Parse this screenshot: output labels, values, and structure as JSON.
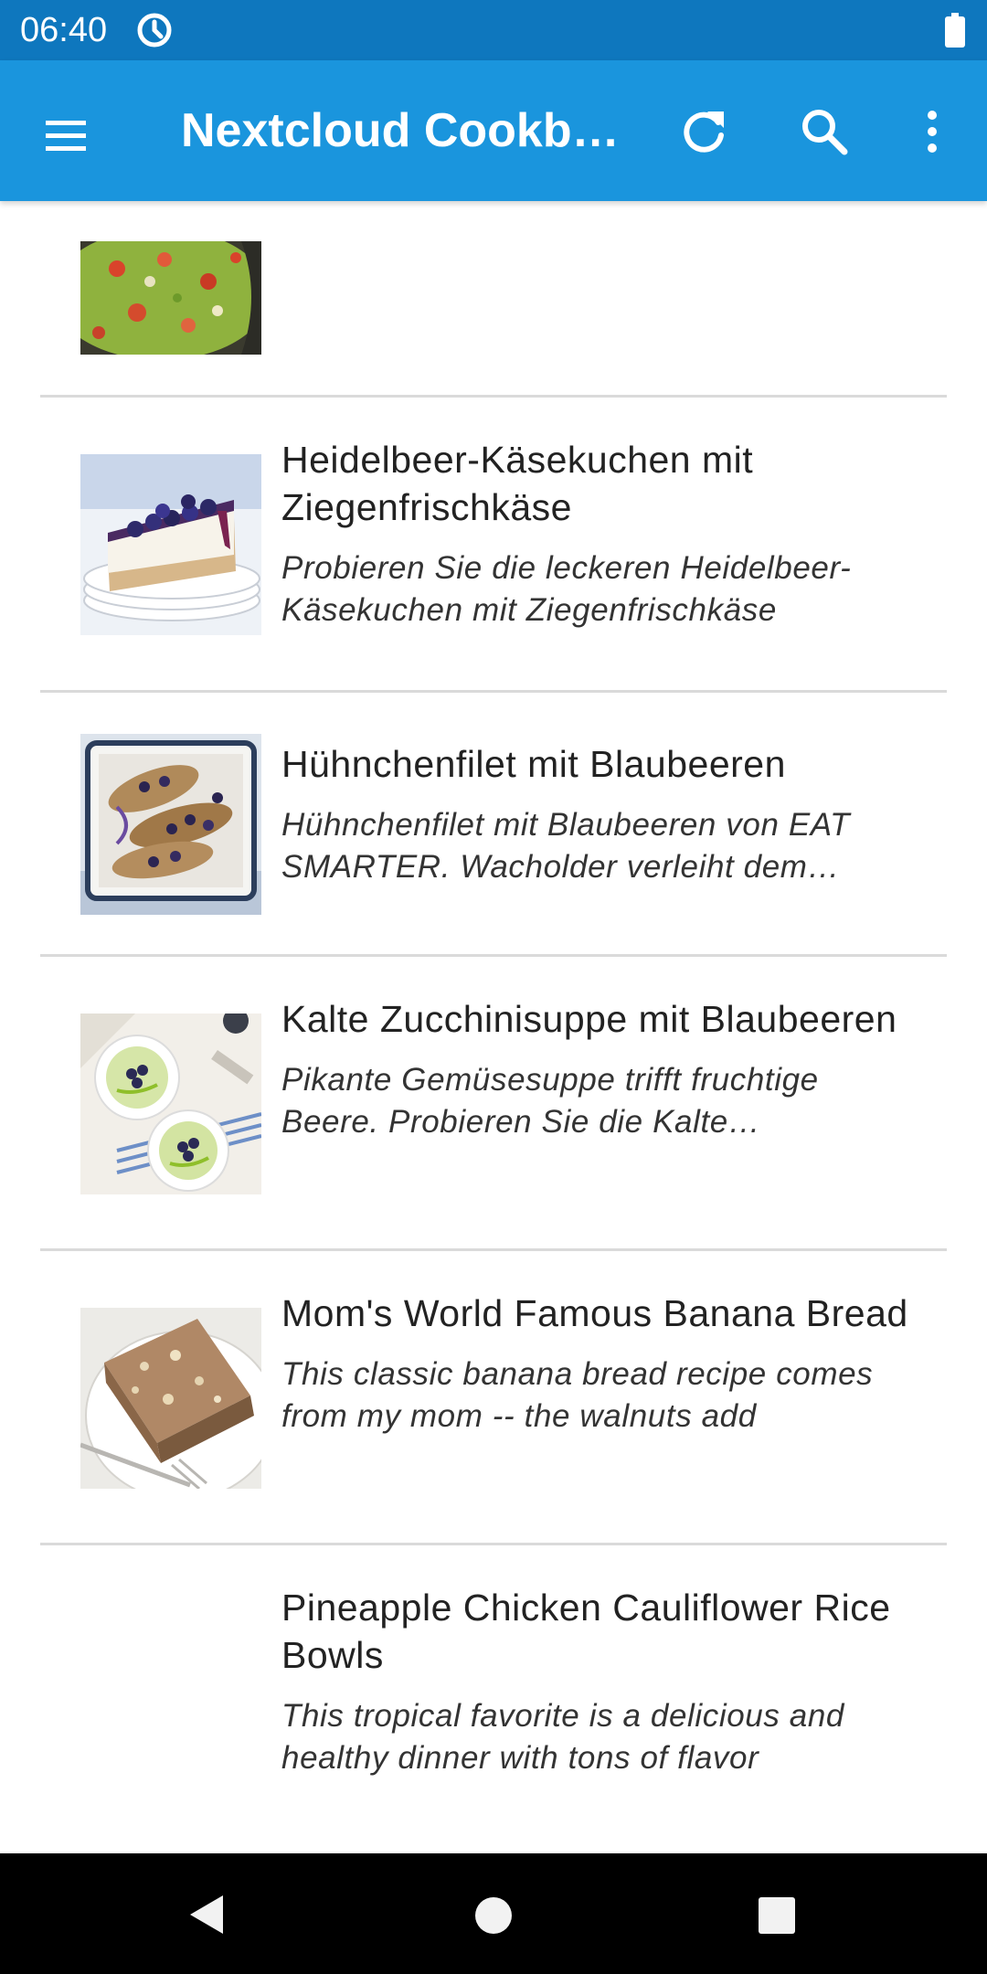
{
  "status_bar": {
    "time": "06:40",
    "sync_icon": "sync-icon",
    "battery_icon": "battery-icon"
  },
  "app_bar": {
    "title": "Nextcloud Cookbook",
    "color": "#1A95DD",
    "status_color": "#0E77BE",
    "actions": [
      "menu-icon",
      "refresh-icon",
      "search-icon",
      "more-vert-icon"
    ]
  },
  "recipes": [
    {
      "title": "",
      "description": "",
      "thumbnail": "guacamole"
    },
    {
      "title": "Heidelbeer-Käsekuchen mit Ziegenfrischkäse",
      "description": "Probieren Sie die leckeren Heidelbeer-Käsekuchen mit Ziegenfrischkäse",
      "thumbnail": "cheesecake"
    },
    {
      "title": "Hühnchenfilet mit Blaubeeren",
      "description": "Hühnchenfilet mit Blaubeeren von EAT SMARTER. Wacholder verleiht dem Gericht",
      "thumbnail": "chicken-blueberries"
    },
    {
      "title": "Kalte Zucchinisuppe mit Blaubeeren",
      "description": "Pikante Gemüsesuppe trifft fruchtige Beere. Probieren Sie die Kalte Zucchinisuppe",
      "thumbnail": "zucchini-soup"
    },
    {
      "title": "Mom's World Famous Banana Bread",
      "description": "This classic banana bread recipe comes from my mom -- the walnuts add",
      "thumbnail": "banana-bread"
    },
    {
      "title": "Pineapple Chicken Cauliflower Rice Bowls",
      "description": "This tropical favorite is a delicious and healthy dinner with tons of flavor",
      "thumbnail": ""
    }
  ],
  "nav_bar": {
    "back_icon": "back-icon",
    "home_icon": "home-icon",
    "recents_icon": "recents-icon"
  }
}
